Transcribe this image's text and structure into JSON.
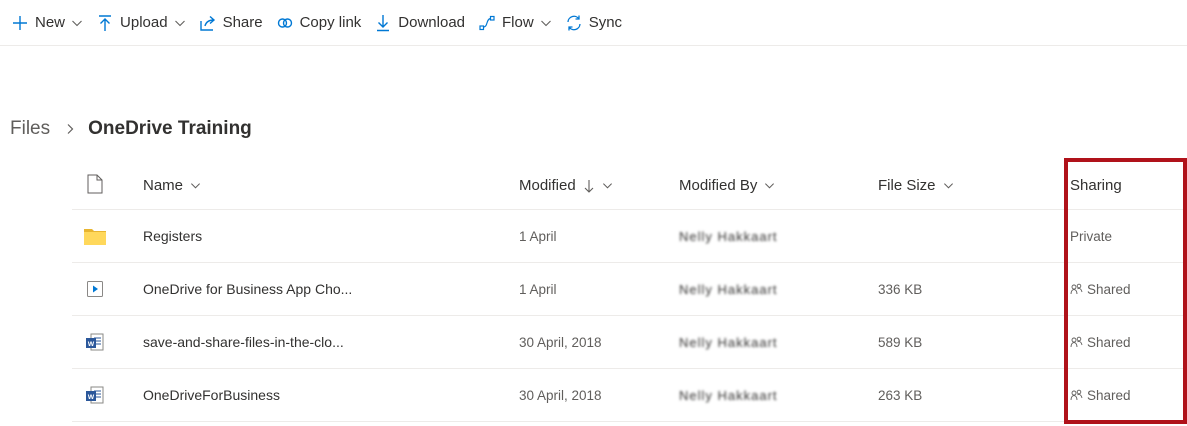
{
  "toolbar": {
    "new_label": "New",
    "upload_label": "Upload",
    "share_label": "Share",
    "copylink_label": "Copy link",
    "download_label": "Download",
    "flow_label": "Flow",
    "sync_label": "Sync"
  },
  "breadcrumb": {
    "root": "Files",
    "current": "OneDrive Training"
  },
  "columns": {
    "name": "Name",
    "modified": "Modified",
    "modified_by": "Modified By",
    "file_size": "File Size",
    "sharing": "Sharing"
  },
  "rows": [
    {
      "icon": "folder-icon",
      "name": "Registers",
      "modified": "1 April",
      "modified_by": "Nelly Hakkaart",
      "size": "",
      "sharing": "Private"
    },
    {
      "icon": "video-file-icon",
      "name": "OneDrive for Business App Cho...",
      "modified": "1 April",
      "modified_by": "Nelly Hakkaart",
      "size": "336 KB",
      "sharing": "Shared"
    },
    {
      "icon": "word-document-icon",
      "name": "save-and-share-files-in-the-clo...",
      "modified": "30 April, 2018",
      "modified_by": "Nelly Hakkaart",
      "size": "589 KB",
      "sharing": "Shared"
    },
    {
      "icon": "word-document-icon",
      "name": "OneDriveForBusiness",
      "modified": "30 April, 2018",
      "modified_by": "Nelly Hakkaart",
      "size": "263 KB",
      "sharing": "Shared"
    }
  ],
  "colors": {
    "accent": "#0078d4",
    "highlight": "#b0121a",
    "folder": "#ffd85b",
    "word": "#2b579a"
  }
}
